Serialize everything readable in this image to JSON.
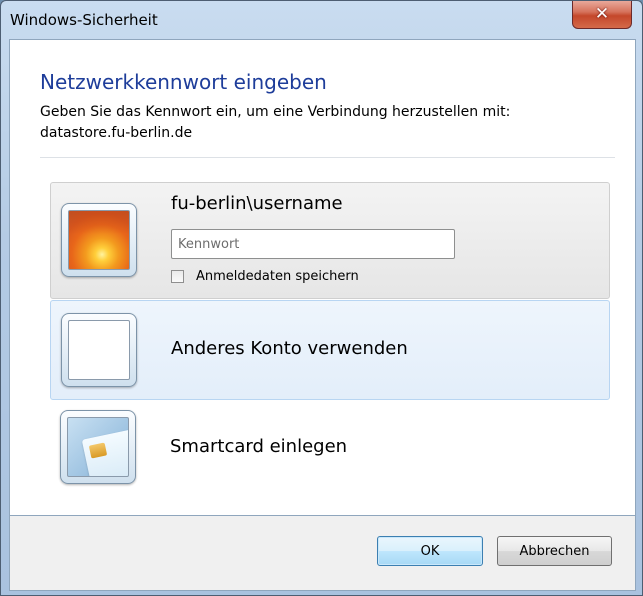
{
  "window": {
    "title": "Windows-Sicherheit",
    "close_icon": "close-icon"
  },
  "dialog": {
    "heading": "Netzwerkkennwort eingeben",
    "description_line1": "Geben Sie das Kennwort ein, um eine Verbindung herzustellen mit:",
    "description_line2": "datastore.fu-berlin.de"
  },
  "accounts": {
    "current": {
      "username": "fu-berlin\\username",
      "password_value": "",
      "password_placeholder": "Kennwort",
      "remember_label": "Anmeldedaten speichern",
      "remember_checked": false,
      "icon": "user-flower-avatar-icon"
    },
    "other": {
      "label": "Anderes Konto verwenden",
      "icon": "blank-account-icon"
    },
    "smartcard": {
      "label": "Smartcard einlegen",
      "icon": "smartcard-icon"
    }
  },
  "buttons": {
    "ok": "OK",
    "cancel": "Abbrechen"
  },
  "colors": {
    "heading": "#1e3d9a",
    "selected_tile": "#e3eefa",
    "close_button": "#c4472b"
  }
}
